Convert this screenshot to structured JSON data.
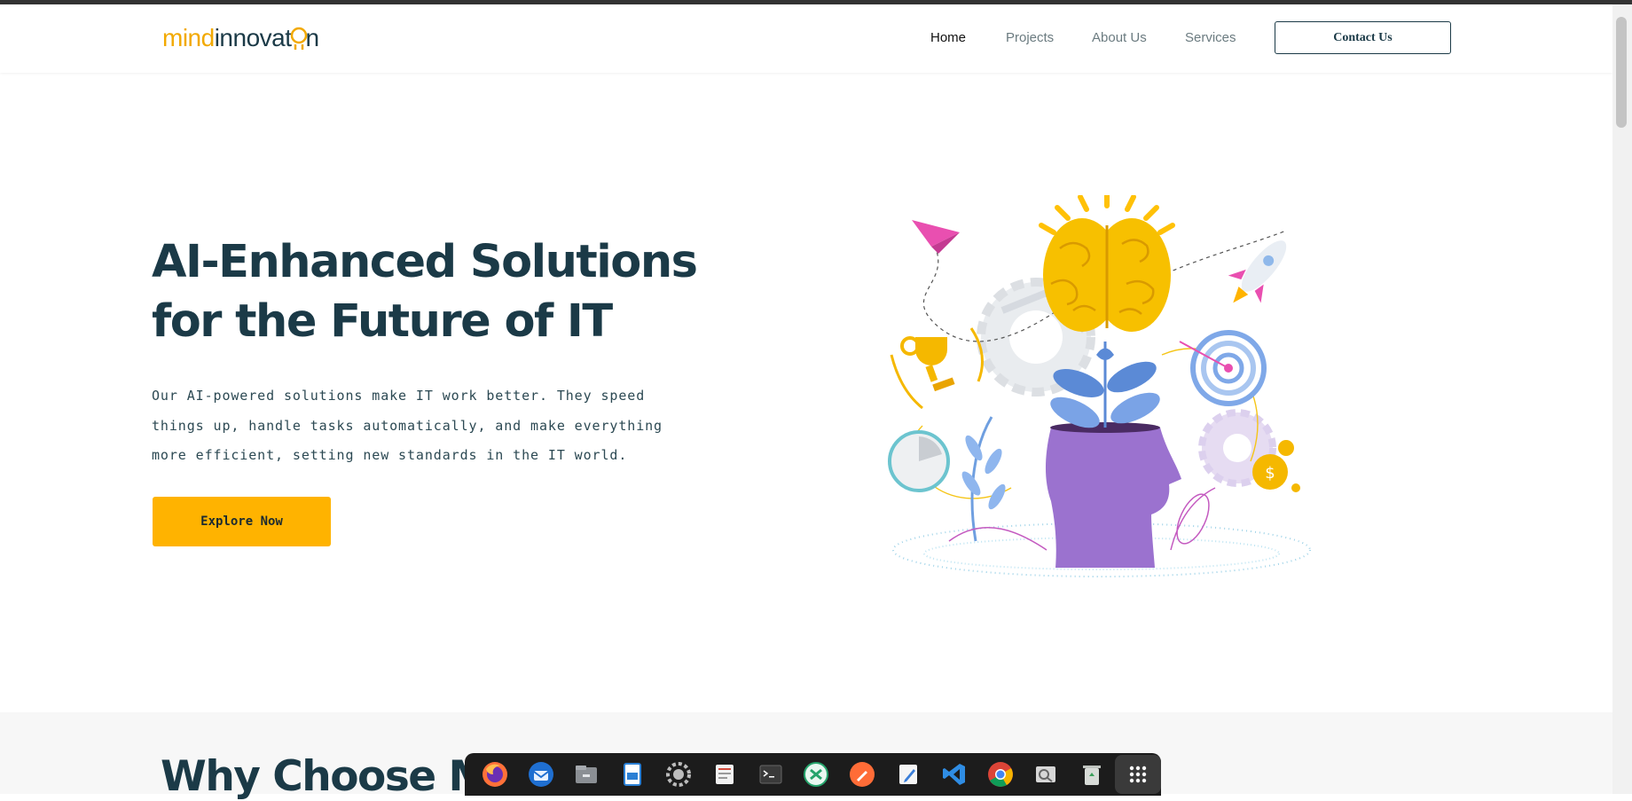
{
  "brand": {
    "logo_mind": "mind",
    "logo_innov": "innovat",
    "logo_tail": "n",
    "accent": "#ffb300",
    "dark": "#1b3a47"
  },
  "nav": {
    "items": [
      "Home",
      "Projects",
      "About Us",
      "Services"
    ],
    "active": "Home",
    "contact_label": "Contact Us"
  },
  "hero": {
    "title": "AI-Enhanced Solutions for the Future of IT",
    "description": "Our AI-powered solutions make IT work better. They speed things up, handle tasks automatically, and make everything more efficient, setting new standards in the IT world.",
    "cta_label": "Explore Now",
    "illustration": "head-with-brain-growing-plant-icon"
  },
  "section2": {
    "title_visible": "Why Choose M"
  },
  "dock": {
    "apps": [
      "firefox-icon",
      "thunderbird-icon",
      "files-icon",
      "writer-icon",
      "settings-icon",
      "document-viewer-icon",
      "terminal-icon",
      "remote-desktop-icon",
      "postman-icon",
      "text-editor-icon",
      "vscode-icon",
      "chrome-icon",
      "image-viewer-icon",
      "trash-icon",
      "app-grid-icon"
    ]
  }
}
